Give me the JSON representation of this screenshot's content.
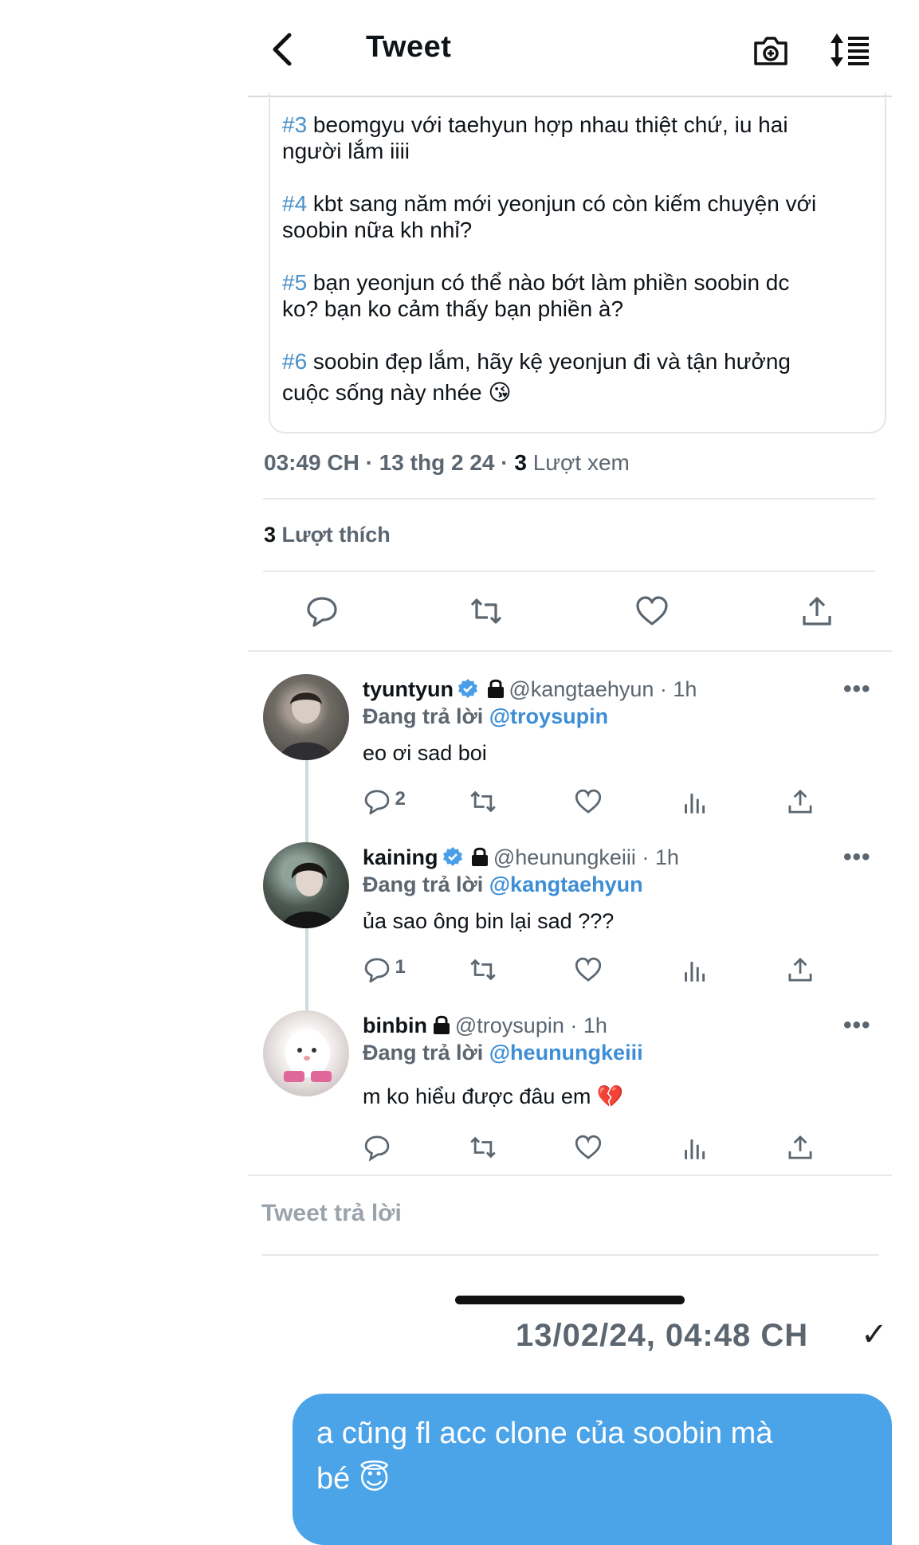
{
  "header": {
    "title": "Tweet"
  },
  "card": {
    "items": [
      {
        "tag": "#3",
        "line1": " beomgyu với taehyun hợp nhau thiệt chứ, iu hai",
        "line2": "người lắm iiii"
      },
      {
        "tag": "#4",
        "line1": " kbt sang năm mới yeonjun có còn kiếm chuyện với",
        "line2": "soobin nữa kh nhỉ?"
      },
      {
        "tag": "#5",
        "line1": " bạn yeonjun có thể nào bớt làm phiền soobin dc",
        "line2": "ko? bạn ko cảm thấy bạn phiền à?"
      },
      {
        "tag": "#6",
        "line1": " soobin đẹp lắm, hãy kệ yeonjun đi và tận hưởng",
        "line2": "cuộc sống này nhée 😘"
      }
    ]
  },
  "meta": {
    "time": "03:49 CH",
    "date": "13 thg 2 24",
    "views_count": "3",
    "views_label": "Lượt xem",
    "likes_count": "3",
    "likes_label": "Lượt thích",
    "sep": "·"
  },
  "replies": [
    {
      "name": "tyuntyun",
      "handle": "@kangtaehyun · 1h",
      "replying_label": "Đang trả lời",
      "replying_to": "@troysupin",
      "text": "eo ơi sad boi",
      "reply_count": "2",
      "verified": true,
      "avatar_color": "#6f6a64"
    },
    {
      "name": "kaining",
      "handle": "@heunungkeiii · 1h",
      "replying_label": "Đang trả lời",
      "replying_to": "@kangtaehyun",
      "text": "ủa sao ông bin lại sad ???",
      "reply_count": "1",
      "verified": true,
      "avatar_color": "#4d5a52"
    },
    {
      "name": "binbin",
      "handle": "@troysupin · 1h",
      "replying_label": "Đang trả lời",
      "replying_to": "@heunungkeiii",
      "text": "m ko hiểu được đâu em 💔",
      "reply_count": "",
      "verified": false,
      "avatar_color": "#e9e4e2"
    }
  ],
  "reply_box": {
    "placeholder": "Tweet trả lời"
  },
  "chat": {
    "timestamp": "13/02/24, 04:48 CH",
    "check": "✓",
    "bubble_line1": "a cũng fl acc clone của soobin mà",
    "bubble_line2": "bé 😇"
  },
  "colors": {
    "accent": "#4ba3e8",
    "link": "#3d8ed6",
    "verified": "#4a9ee8"
  }
}
